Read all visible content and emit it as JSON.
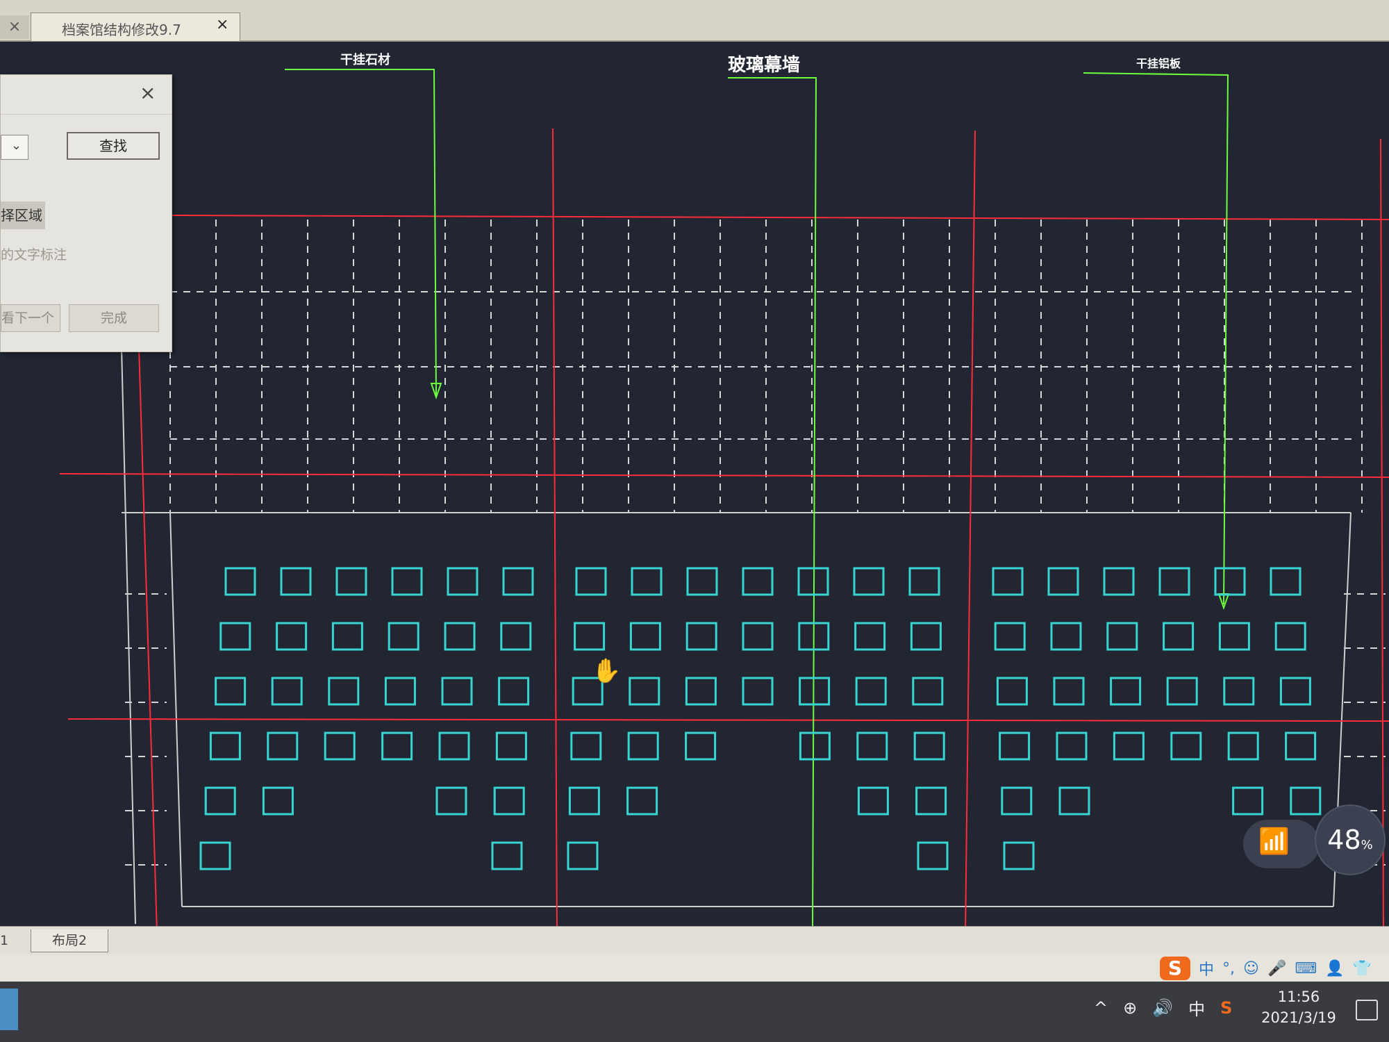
{
  "window": {
    "tab_prev_label": "×",
    "tab_title": "档案馆结构修改9.7",
    "tab_close": "×"
  },
  "dialog": {
    "close": "×",
    "combo_arrow": "⌄",
    "find_button": "查找",
    "select_area_label": "择区域",
    "option_text": "的文字标注",
    "next_button": "看下一个",
    "done_button": "完成"
  },
  "drawing": {
    "labels": [
      {
        "id": "dry-stone",
        "text": "干挂石材"
      },
      {
        "id": "glass-curtain",
        "text": "玻璃幕墙"
      },
      {
        "id": "dry-aluminum",
        "text": "干挂铝板"
      }
    ],
    "colors": {
      "background": "#212632",
      "red_line": "#ff2b3a",
      "green_leader": "#6cff3c",
      "cyan_square": "#38d6d2",
      "dashed_grid": "#d7d7d7"
    }
  },
  "layout_tabs": {
    "tab1": "1",
    "tab2": "布局2"
  },
  "ime": {
    "logo": "S",
    "items": [
      {
        "id": "lang",
        "label": "中"
      },
      {
        "id": "punct",
        "label": "°,"
      },
      {
        "id": "emoji",
        "label": "☺"
      },
      {
        "id": "mic",
        "label": "🎤"
      },
      {
        "id": "keyboard",
        "label": "⌨"
      },
      {
        "id": "user",
        "label": "👤"
      },
      {
        "id": "skin",
        "label": "👕"
      }
    ]
  },
  "taskbar": {
    "tray": [
      {
        "id": "chevron",
        "label": "^"
      },
      {
        "id": "network",
        "label": "⊕"
      },
      {
        "id": "volume",
        "label": "🔊"
      },
      {
        "id": "ime",
        "label": "中"
      },
      {
        "id": "sogou",
        "label": "S"
      }
    ],
    "time": "11:56",
    "date": "2021/3/19"
  },
  "overlay": {
    "wifi": "📶",
    "battery_value": "48",
    "battery_unit": "%"
  }
}
